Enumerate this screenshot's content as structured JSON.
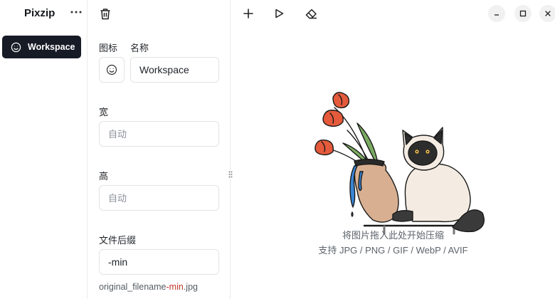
{
  "sidebar": {
    "app_title": "Pixzip",
    "workspace_label": "Workspace"
  },
  "settings": {
    "icon_label": "图标",
    "name_label": "名称",
    "name_value": "Workspace",
    "width_label": "宽",
    "width_placeholder": "自动",
    "height_label": "高",
    "height_placeholder": "自动",
    "suffix_label": "文件后缀",
    "suffix_value": "-min",
    "preview_prefix": "original_filename",
    "preview_suffix": "-min",
    "preview_ext": ".jpg"
  },
  "main": {
    "drop_title": "将图片拖入此处开始压缩",
    "drop_formats": "支持 JPG / PNG / GIF / WebP / AVIF"
  },
  "icons": {
    "sidebar": [
      "more-icon",
      "smile-icon"
    ],
    "panel": [
      "trash-icon",
      "smile-icon",
      "grip-icon"
    ],
    "toolbar": [
      "plus-icon",
      "play-icon",
      "eraser-icon"
    ],
    "window": [
      "minimize-icon",
      "maximize-icon",
      "close-icon"
    ]
  },
  "colors": {
    "selected_bg": "#161b26",
    "accent": "#c0392b",
    "border": "#e3e3e3"
  }
}
